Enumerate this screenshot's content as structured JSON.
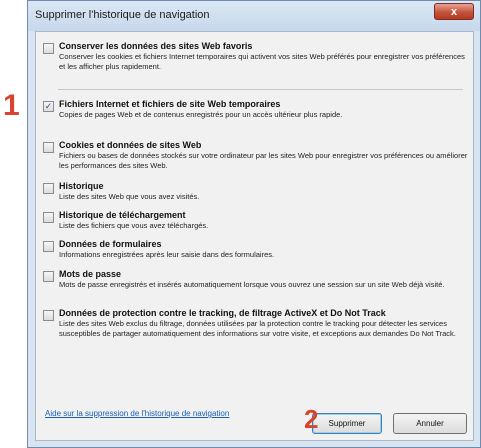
{
  "window": {
    "title": "Supprimer l'historique de navigation",
    "close_label": "x"
  },
  "options": [
    {
      "label": "Conserver les données des sites Web favoris",
      "checked": false,
      "description": "Conserver les cookies et fichiers Internet temporaires qui activent vos sites Web préférés pour enregistrer vos préférences et les afficher plus rapidement."
    },
    {
      "label": "Fichiers Internet et fichiers de site Web temporaires",
      "checked": true,
      "description": "Copies de pages Web et de contenus enregistrés pour un accès ultérieur plus rapide."
    },
    {
      "label": "Cookies et données de sites Web",
      "checked": false,
      "description": "Fichiers ou bases de données stockés sur votre ordinateur par les sites Web pour enregistrer vos préférences ou améliorer les performances des sites Web."
    },
    {
      "label": "Historique",
      "checked": false,
      "description": "Liste des sites Web que vous avez visités."
    },
    {
      "label": "Historique de téléchargement",
      "checked": false,
      "description": "Liste des fichiers que vous avez téléchargés."
    },
    {
      "label": "Données de formulaires",
      "checked": false,
      "description": "Informations enregistrées après leur saisie dans des formulaires."
    },
    {
      "label": "Mots de passe",
      "checked": false,
      "description": "Mots de passe enregistrés et insérés automatiquement lorsque vous ouvrez une session sur un site Web déjà visité."
    },
    {
      "label": "Données de protection contre le tracking, de filtrage ActiveX et Do Not Track",
      "checked": false,
      "description": "Liste des sites Web exclus du filtrage, données utilisées par la protection contre le tracking pour détecter les services susceptibles de partager automatiquement des informations sur votre visite, et exceptions aux demandes Do Not Track."
    }
  ],
  "footer": {
    "help_link": "Aide sur la suppression de l'historique de navigation",
    "delete_label": "Supprimer",
    "cancel_label": "Annuler"
  },
  "annotations": {
    "marker_1": "1",
    "marker_2": "2"
  },
  "colors": {
    "annotation": "#d9442e",
    "link": "#1a5fb4",
    "check": "#2b4fa0"
  }
}
